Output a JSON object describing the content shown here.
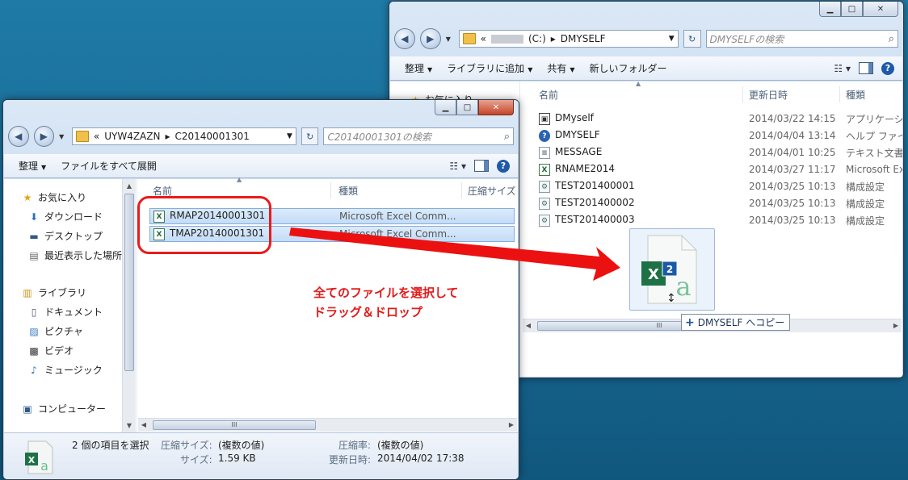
{
  "right_window": {
    "address": {
      "prefix": "«",
      "drive": "(C:)",
      "sep": "▸",
      "folder": "DMYSELF"
    },
    "search_placeholder": "DMYSELFの検索",
    "commands": [
      {
        "label": "整理",
        "dropdown": true
      },
      {
        "label": "ライブラリに追加",
        "dropdown": true
      },
      {
        "label": "共有",
        "dropdown": true
      },
      {
        "label": "新しいフォルダー",
        "dropdown": false
      }
    ],
    "nav_partial": "お気に入り",
    "columns": {
      "name": "名前",
      "date": "更新日時",
      "type": "種類"
    },
    "files": [
      {
        "icon": "app",
        "name": "DMyself",
        "date": "2014/03/22 14:15",
        "type": "アプリケーション"
      },
      {
        "icon": "help",
        "name": "DMYSELF",
        "date": "2014/04/04 13:14",
        "type": "ヘルプ ファイル"
      },
      {
        "icon": "txt",
        "name": "MESSAGE",
        "date": "2014/04/01 10:25",
        "type": "テキスト文書"
      },
      {
        "icon": "xl",
        "name": "RNAME2014",
        "date": "2014/03/27 11:17",
        "type": "Microsoft Excel"
      },
      {
        "icon": "cfg",
        "name": "TEST201400001",
        "date": "2014/03/25 10:13",
        "type": "構成設定"
      },
      {
        "icon": "cfg",
        "name": "TEST201400002",
        "date": "2014/03/25 10:13",
        "type": "構成設定"
      },
      {
        "icon": "cfg",
        "name": "TEST201400003",
        "date": "2014/03/25 10:13",
        "type": "構成設定"
      }
    ],
    "drag_badge": "2",
    "copy_tooltip": "DMYSELF へコピー",
    "hscroll_grip": "III"
  },
  "left_window": {
    "address": {
      "prefix": "«",
      "part1": "UYW4ZAZN",
      "sep": "▸",
      "folder": "C20140001301"
    },
    "search_placeholder": "C20140001301の検索",
    "commands": [
      {
        "label": "整理",
        "dropdown": true
      },
      {
        "label": "ファイルをすべて展開",
        "dropdown": false
      }
    ],
    "nav_items": [
      {
        "icon": "star-icon",
        "label": "お気に入り"
      },
      {
        "icon": "download-folder-icon",
        "label": "ダウンロード"
      },
      {
        "icon": "desktop-icon",
        "label": "デスクトップ"
      },
      {
        "icon": "recent-places-icon",
        "label": "最近表示した場所"
      },
      {
        "icon": "library-icon",
        "label": "ライブラリ"
      },
      {
        "icon": "documents-icon",
        "label": "ドキュメント"
      },
      {
        "icon": "pictures-icon",
        "label": "ピクチャ"
      },
      {
        "icon": "video-icon",
        "label": "ビデオ"
      },
      {
        "icon": "music-icon",
        "label": "ミュージック"
      },
      {
        "icon": "computer-icon",
        "label": "コンピューター"
      }
    ],
    "columns": {
      "name": "名前",
      "type": "種類",
      "size": "圧縮サイズ"
    },
    "files": [
      {
        "name": "RMAP20140001301",
        "type": "Microsoft Excel Comm..."
      },
      {
        "name": "TMAP20140001301",
        "type": "Microsoft Excel Comm..."
      }
    ],
    "details": {
      "selection": "2 個の項目を選択",
      "compressed_size_label": "圧縮サイズ:",
      "compressed_size_value": "(複数の値)",
      "size_label": "サイズ:",
      "size_value": "1.59 KB",
      "ratio_label": "圧縮率:",
      "ratio_value": "(複数の値)",
      "modified_label": "更新日時:",
      "modified_value": "2014/04/02 17:38"
    },
    "hscroll_grip": "III"
  },
  "annotation": {
    "line1": "全てのファイルを選択して",
    "line2": "ドラッグ＆ドロップ",
    "color": "#e21b1b"
  }
}
